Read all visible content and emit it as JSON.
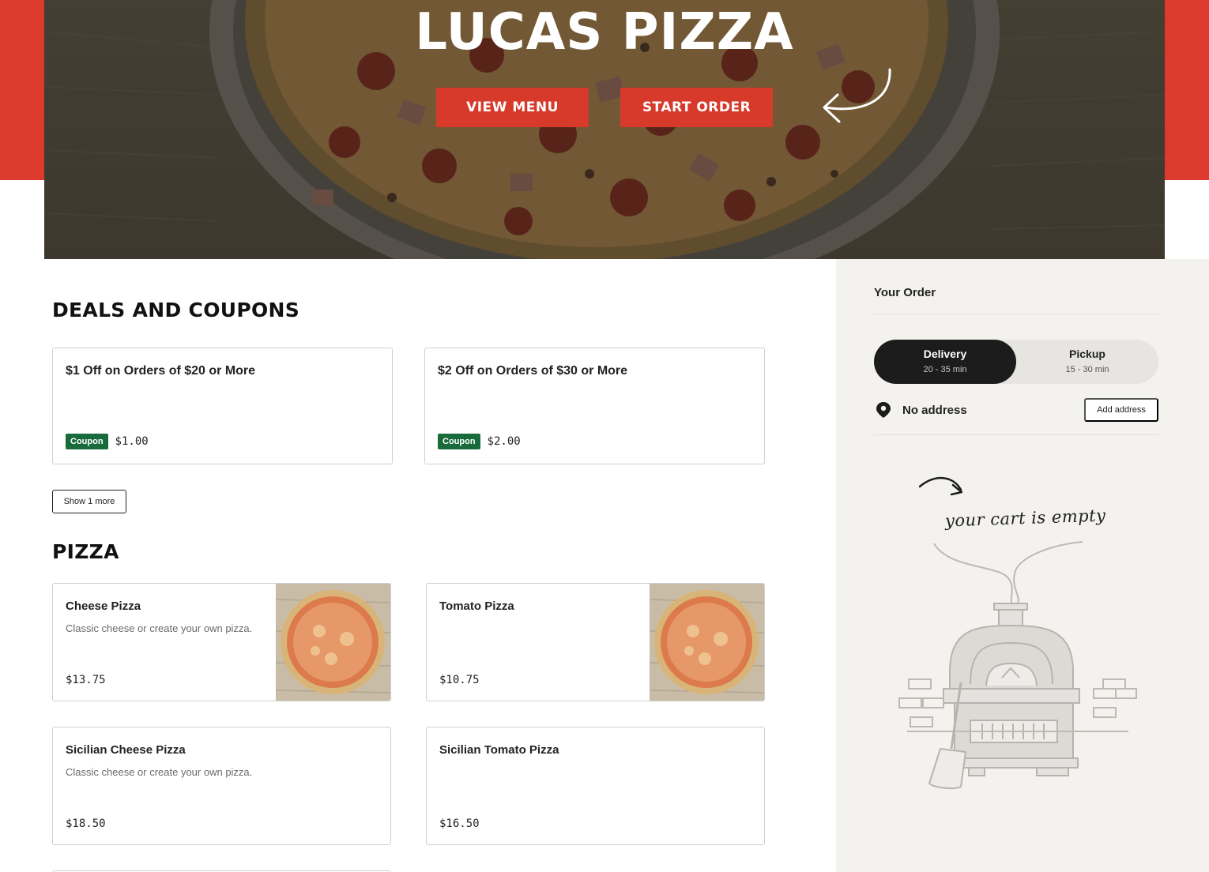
{
  "brand": {
    "title": "LUCAS PIZZA",
    "accent_color": "#dc3a2c"
  },
  "hero": {
    "view_menu_label": "VIEW MENU",
    "start_order_label": "START ORDER",
    "arrow_icon": "curved-arrow-icon"
  },
  "deals": {
    "title": "DEALS AND COUPONS",
    "items": [
      {
        "title": "$1 Off on Orders of $20 or More",
        "badge": "Coupon",
        "price": "$1.00"
      },
      {
        "title": "$2 Off on Orders of $30 or More",
        "badge": "Coupon",
        "price": "$2.00"
      }
    ],
    "show_more_label": "Show 1 more",
    "badge_color": "#1a6b3c"
  },
  "pizza": {
    "title": "PIZZA",
    "items": [
      {
        "name": "Cheese Pizza",
        "description": "Classic cheese or create your own pizza.",
        "price": "$13.75",
        "has_image": true
      },
      {
        "name": "Tomato Pizza",
        "description": "",
        "price": "$10.75",
        "has_image": true
      },
      {
        "name": "Sicilian Cheese Pizza",
        "description": "Classic cheese or create your own pizza.",
        "price": "$18.50",
        "has_image": false
      },
      {
        "name": "Sicilian Tomato Pizza",
        "description": "",
        "price": "$16.50",
        "has_image": false
      }
    ]
  },
  "order": {
    "title": "Your Order",
    "delivery": {
      "label": "Delivery",
      "time": "20 - 35 min",
      "active": true
    },
    "pickup": {
      "label": "Pickup",
      "time": "15 - 30 min",
      "active": false
    },
    "address_icon": "location-pin-icon",
    "address_text": "No address",
    "add_address_label": "Add address",
    "empty_cart_text": "your cart is empty",
    "empty_illustration": "pizza-oven-illustration"
  }
}
